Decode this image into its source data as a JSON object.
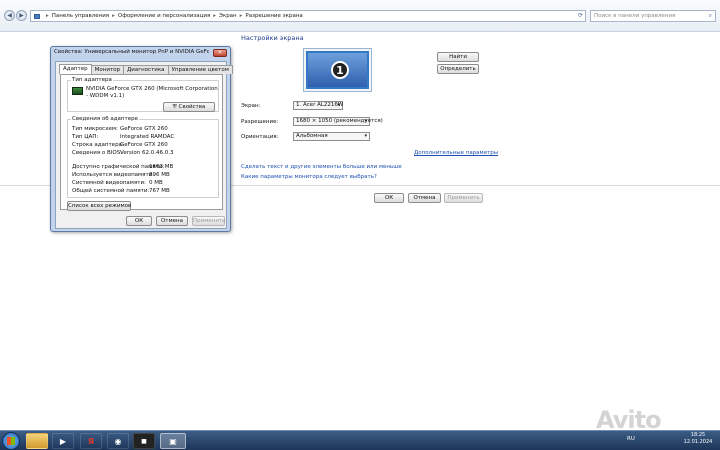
{
  "addressbar": {
    "crumbs": [
      "Панель управления",
      "Оформление и персонализация",
      "Экран",
      "Разрешение экрана"
    ],
    "search_placeholder": "Поиск в панели управления"
  },
  "panel": {
    "title": "Настройки экрана",
    "monitor_number": "1",
    "find_button": "Найти",
    "identify_button": "Определить",
    "screen_label": "Экран:",
    "screen_value": "1. Acer AL2216W",
    "resolution_label": "Разрешение:",
    "resolution_value": "1680 × 1050 (рекомендуется)",
    "orientation_label": "Ориентация:",
    "orientation_value": "Альбомная",
    "advanced_link": "Дополнительные параметры",
    "text_size_link": "Сделать текст и другие элементы больше или меньше",
    "which_settings_link": "Какие параметры монитора следует выбрать?",
    "ok_button": "ОК",
    "cancel_button": "Отмена",
    "apply_button": "Применить"
  },
  "dialog": {
    "title": "Свойства: Универсальный монитор PnP и NVIDIA GeForce GTX ...",
    "tabs": [
      "Адаптер",
      "Монитор",
      "Диагностика",
      "Управление цветом"
    ],
    "adapter_type_label": "Тип адаптера",
    "adapter_name": "NVIDIA GeForce GTX 260 (Microsoft Corporation - WDDM v1.1)",
    "properties_button": "Свойства",
    "adapter_info_label": "Сведения об адаптере",
    "info_rows": [
      {
        "label": "Тип микросхем:",
        "value": "GeForce GTX 260"
      },
      {
        "label": "Тип ЦАП:",
        "value": "Integrated RAMDAC"
      },
      {
        "label": "Строка адаптера:",
        "value": "GeForce GTX 260"
      },
      {
        "label": "Сведения о BIOS:",
        "value": "Version 62.0.46.0.3"
      }
    ],
    "memory_rows": [
      {
        "label": "Доступно графической памяти:",
        "value": "1663 MB"
      },
      {
        "label": "Используется видеопамяти:",
        "value": "896 MB"
      },
      {
        "label": "Системной видеопамяти:",
        "value": "0 MB"
      },
      {
        "label": "Общей системной памяти:",
        "value": "767 MB"
      }
    ],
    "list_modes_button": "Список всех режимов",
    "ok_button": "ОК",
    "cancel_button": "Отмена",
    "apply_button": "Применить"
  },
  "taskbar": {
    "lang": "RU",
    "time": "18:25",
    "date": "12.01.2024"
  },
  "watermark": "Avito"
}
